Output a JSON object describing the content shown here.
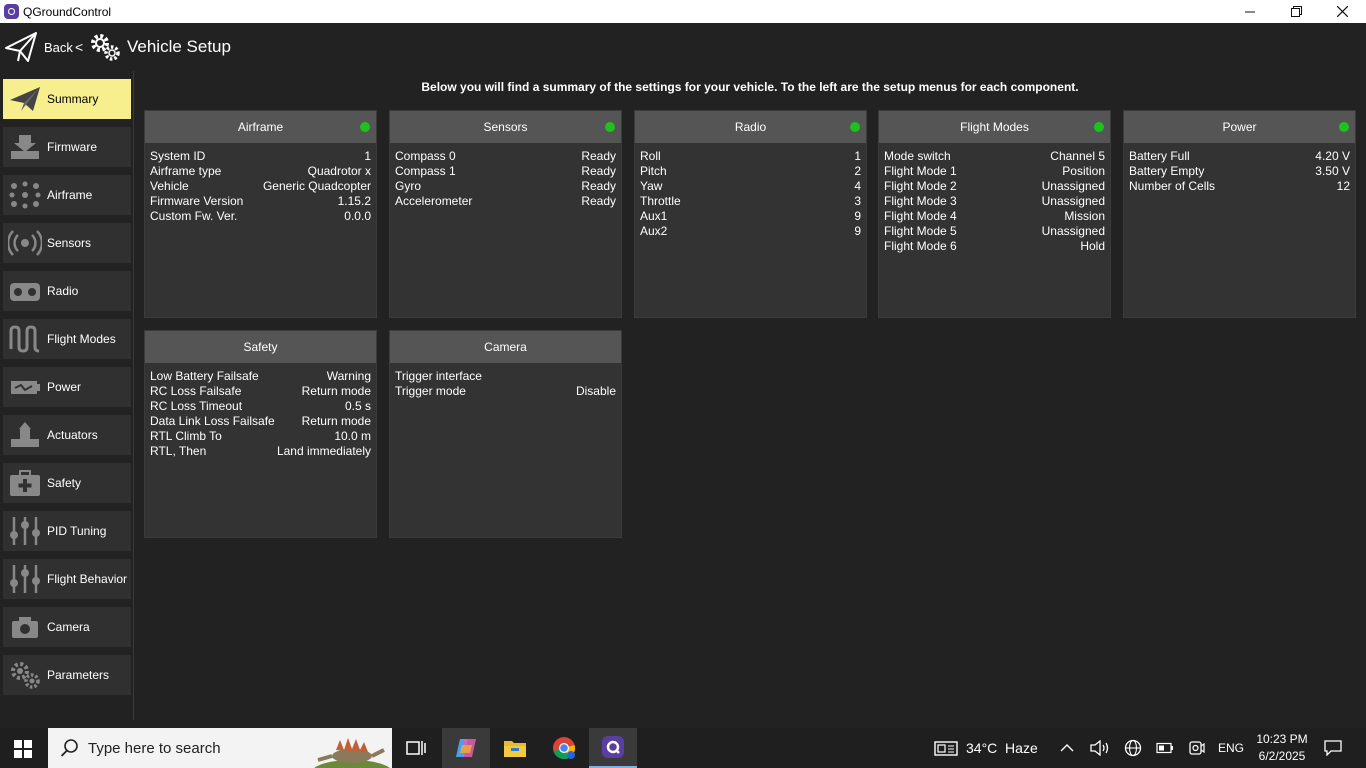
{
  "window": {
    "title": "QGroundControl"
  },
  "toolbar": {
    "back_label": "Back",
    "separator": "<",
    "page_title": "Vehicle Setup"
  },
  "sidebar": {
    "items": [
      {
        "label": "Summary",
        "icon": "paper-plane-icon",
        "active": true
      },
      {
        "label": "Firmware",
        "icon": "download-icon"
      },
      {
        "label": "Airframe",
        "icon": "airframe-dots-icon"
      },
      {
        "label": "Sensors",
        "icon": "sensor-waves-icon"
      },
      {
        "label": "Radio",
        "icon": "radio-transmitter-icon"
      },
      {
        "label": "Flight Modes",
        "icon": "flight-modes-wave-icon"
      },
      {
        "label": "Power",
        "icon": "battery-power-icon"
      },
      {
        "label": "Actuators",
        "icon": "actuator-icon"
      },
      {
        "label": "Safety",
        "icon": "first-aid-kit-icon"
      },
      {
        "label": "PID Tuning",
        "icon": "sliders-icon"
      },
      {
        "label": "Flight Behavior",
        "icon": "sliders-icon"
      },
      {
        "label": "Camera",
        "icon": "camera-icon"
      },
      {
        "label": "Parameters",
        "icon": "gears-icon"
      }
    ]
  },
  "main": {
    "intro": "Below you will find a summary of the settings for your vehicle. To the left are the setup menus for each component.",
    "cards": [
      {
        "title": "Airframe",
        "status_ok": true,
        "rows": [
          [
            "System ID",
            "1"
          ],
          [
            "Airframe type",
            "Quadrotor x"
          ],
          [
            "Vehicle",
            "Generic Quadcopter"
          ],
          [
            "Firmware Version",
            "1.15.2"
          ],
          [
            "Custom Fw. Ver.",
            "0.0.0"
          ]
        ]
      },
      {
        "title": "Sensors",
        "status_ok": true,
        "rows": [
          [
            "Compass 0",
            "Ready"
          ],
          [
            "Compass 1",
            "Ready"
          ],
          [
            "Gyro",
            "Ready"
          ],
          [
            "Accelerometer",
            "Ready"
          ]
        ]
      },
      {
        "title": "Radio",
        "status_ok": true,
        "rows": [
          [
            "Roll",
            "1"
          ],
          [
            "Pitch",
            "2"
          ],
          [
            "Yaw",
            "4"
          ],
          [
            "Throttle",
            "3"
          ],
          [
            "Aux1",
            "9"
          ],
          [
            "Aux2",
            "9"
          ]
        ]
      },
      {
        "title": "Flight Modes",
        "status_ok": true,
        "rows": [
          [
            "Mode switch",
            "Channel 5"
          ],
          [
            "Flight Mode 1",
            "Position"
          ],
          [
            "Flight Mode 2",
            "Unassigned"
          ],
          [
            "Flight Mode 3",
            "Unassigned"
          ],
          [
            "Flight Mode 4",
            "Mission"
          ],
          [
            "Flight Mode 5",
            "Unassigned"
          ],
          [
            "Flight Mode 6",
            "Hold"
          ]
        ]
      },
      {
        "title": "Power",
        "status_ok": true,
        "rows": [
          [
            "Battery Full",
            "4.20 V"
          ],
          [
            "Battery Empty",
            "3.50 V"
          ],
          [
            "Number of Cells",
            "12"
          ]
        ]
      },
      {
        "title": "Safety",
        "status_ok": false,
        "rows": [
          [
            "Low Battery Failsafe",
            "Warning"
          ],
          [
            "RC Loss Failsafe",
            "Return mode"
          ],
          [
            "RC Loss Timeout",
            "0.5 s"
          ],
          [
            "Data Link Loss Failsafe",
            "Return mode"
          ],
          [
            "RTL Climb To",
            "10.0 m"
          ],
          [
            "RTL, Then",
            "Land immediately"
          ]
        ]
      },
      {
        "title": "Camera",
        "status_ok": false,
        "rows": [
          [
            "Trigger interface",
            ""
          ],
          [
            "Trigger mode",
            "Disable"
          ]
        ]
      }
    ]
  },
  "taskbar": {
    "search_placeholder": "Type here to search",
    "weather": "34°C  Haze",
    "language": "ENG",
    "time": "10:23 PM",
    "date": "6/2/2025"
  },
  "colors": {
    "active_item": "#f7ef8d",
    "status_ok": "#1ec11e",
    "card_header": "#555555",
    "card_body": "#333333"
  }
}
